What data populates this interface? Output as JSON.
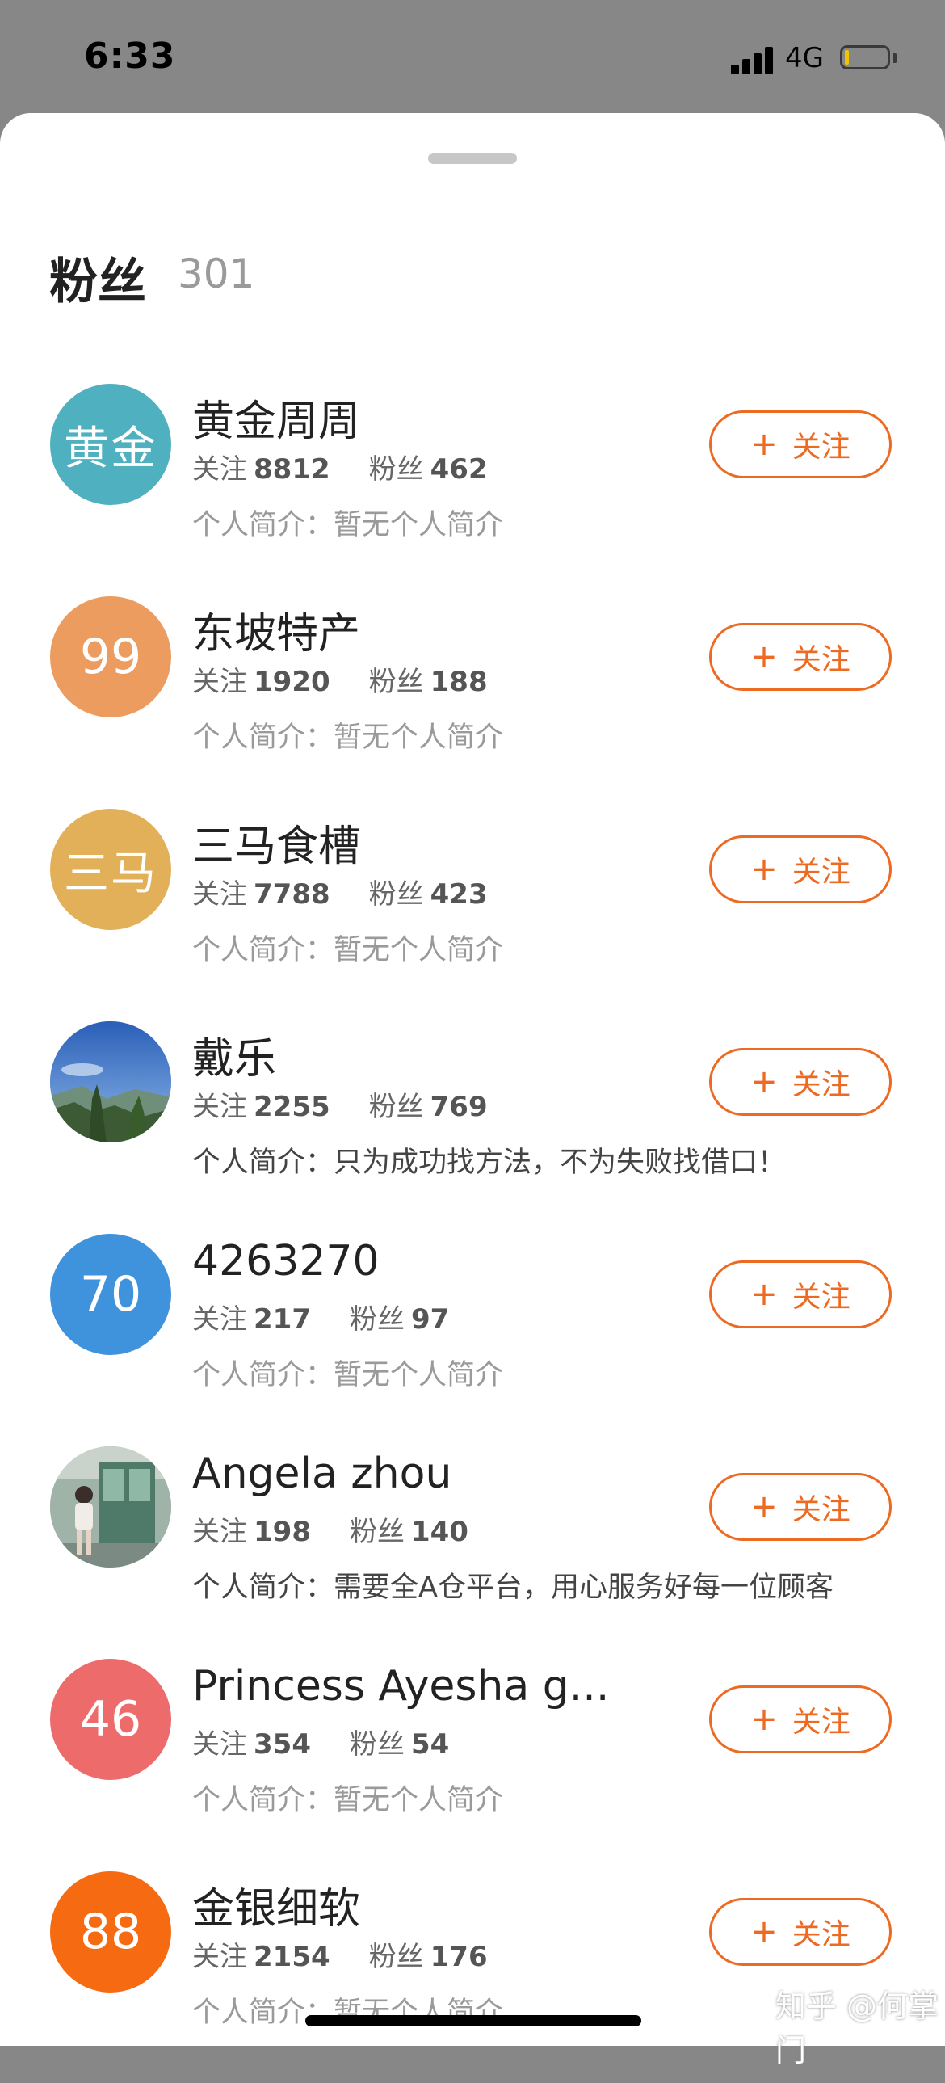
{
  "status_bar": {
    "time": "6:33",
    "network": "4G",
    "battery_level": 0.1
  },
  "sheet": {
    "title": "粉丝",
    "count": "301"
  },
  "followers": [
    {
      "name": "黄金周周",
      "avatar_text": "黄金",
      "avatar_color": "#4fb0c0",
      "following_label": "关注",
      "following": "8812",
      "fans_label": "粉丝",
      "fans": "462",
      "bio": "个人简介：暂无个人简介",
      "follow_label": "关注"
    },
    {
      "name": "东坡特产",
      "avatar_text": "99",
      "avatar_color": "#ec9c5e",
      "following_label": "关注",
      "following": "1920",
      "fans_label": "粉丝",
      "fans": "188",
      "bio": "个人简介：暂无个人简介",
      "follow_label": "关注"
    },
    {
      "name": "三马食槽",
      "avatar_text": "三马",
      "avatar_color": "#e2b058",
      "following_label": "关注",
      "following": "7788",
      "fans_label": "粉丝",
      "fans": "423",
      "bio": "个人简介：暂无个人简介",
      "follow_label": "关注"
    },
    {
      "name": "戴乐",
      "avatar_text": "",
      "avatar_color": "#3f7ec8",
      "following_label": "关注",
      "following": "2255",
      "fans_label": "粉丝",
      "fans": "769",
      "bio": "个人简介：只为成功找方法，不为失败找借口！",
      "follow_label": "关注"
    },
    {
      "name": "4263270",
      "avatar_text": "70",
      "avatar_color": "#3e93dc",
      "following_label": "关注",
      "following": "217",
      "fans_label": "粉丝",
      "fans": "97",
      "bio": "个人简介：暂无个人简介",
      "follow_label": "关注"
    },
    {
      "name": "Angela zhou",
      "avatar_text": "",
      "avatar_color": "#8aa39a",
      "following_label": "关注",
      "following": "198",
      "fans_label": "粉丝",
      "fans": "140",
      "bio": "个人简介：需要全A仓平台，用心服务好每一位顾客",
      "follow_label": "关注"
    },
    {
      "name": "Princess Ayesha g...",
      "avatar_text": "46",
      "avatar_color": "#ee6b6b",
      "following_label": "关注",
      "following": "354",
      "fans_label": "粉丝",
      "fans": "54",
      "bio": "个人简介：暂无个人简介",
      "follow_label": "关注"
    },
    {
      "name": "金银细软",
      "avatar_text": "88",
      "avatar_color": "#f66a12",
      "following_label": "关注",
      "following": "2154",
      "fans_label": "粉丝",
      "fans": "176",
      "bio": "个人简介：暂无个人简介",
      "follow_label": "关注"
    }
  ],
  "watermark": "知乎 @何掌门",
  "colors": {
    "accent": "#ec6a22",
    "overlay": "#878787"
  }
}
